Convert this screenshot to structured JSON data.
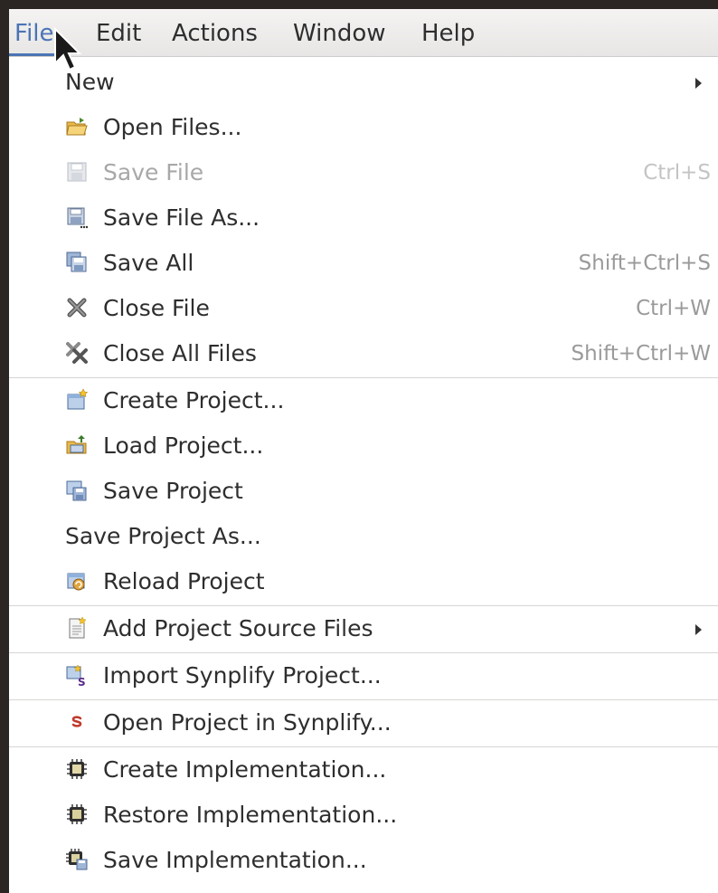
{
  "menubar": {
    "items": [
      "File",
      "Edit",
      "Actions",
      "Window",
      "Help"
    ],
    "active": "File"
  },
  "menu": {
    "new": {
      "label": "New",
      "icon": "none"
    },
    "open_files": {
      "label": "Open Files...",
      "icon": "open-folder-icon"
    },
    "save_file": {
      "label": "Save File",
      "shortcut": "Ctrl+S",
      "icon": "save-file-icon",
      "disabled": true
    },
    "save_file_as": {
      "label": "Save File As...",
      "icon": "save-as-icon"
    },
    "save_all": {
      "label": "Save All",
      "shortcut": "Shift+Ctrl+S",
      "icon": "save-all-icon"
    },
    "close_file": {
      "label": "Close File",
      "shortcut": "Ctrl+W",
      "icon": "close-file-icon"
    },
    "close_all_files": {
      "label": "Close All Files",
      "shortcut": "Shift+Ctrl+W",
      "icon": "close-all-icon"
    },
    "create_project": {
      "label": "Create Project...",
      "icon": "create-project-icon"
    },
    "load_project": {
      "label": "Load Project...",
      "icon": "load-project-icon"
    },
    "save_project": {
      "label": "Save Project",
      "icon": "save-project-icon"
    },
    "save_project_as": {
      "label": "Save Project As...",
      "icon": "none"
    },
    "reload_project": {
      "label": "Reload Project",
      "icon": "reload-project-icon"
    },
    "add_project_source_files": {
      "label": "Add Project Source Files",
      "icon": "add-source-files-icon"
    },
    "import_synplify_project": {
      "label": "Import Synplify Project...",
      "icon": "import-synplify-icon"
    },
    "open_project_in_synplify": {
      "label": "Open Project in Synplify...",
      "icon": "synplify-icon"
    },
    "create_implementation": {
      "label": "Create Implementation...",
      "icon": "chip-icon"
    },
    "restore_implementation": {
      "label": "Restore Implementation...",
      "icon": "chip-icon"
    },
    "save_implementation": {
      "label": "Save Implementation...",
      "icon": "chip-save-icon"
    }
  },
  "colors": {
    "accent": "#4b74b5",
    "text": "#2e2e2e",
    "disabled_text": "#a8a8a8",
    "shortcut_text": "#9a9a9a"
  }
}
